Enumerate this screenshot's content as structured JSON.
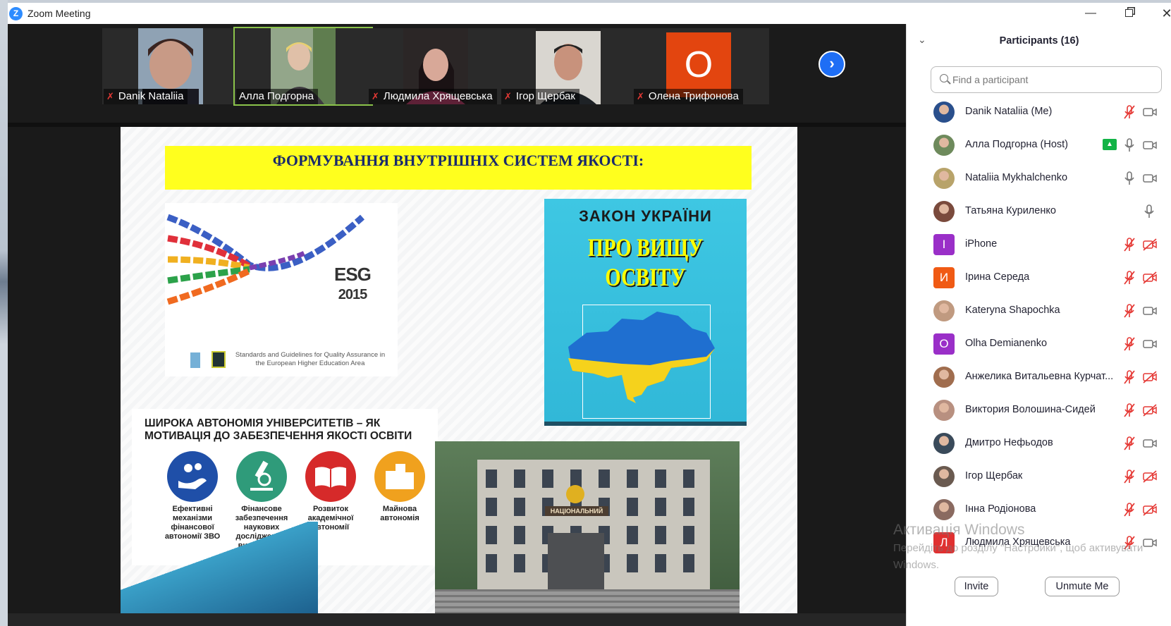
{
  "window": {
    "title": "Zoom Meeting",
    "minimize": "—",
    "close": "✕"
  },
  "video_strip": {
    "tiles": [
      {
        "name": "Danik Nataliia",
        "muted": true
      },
      {
        "name": "Алла Подгорна",
        "muted": false,
        "active_speaker": true
      },
      {
        "name": "Людмила Хрящевська",
        "muted": true
      },
      {
        "name": "Ігор Щербак",
        "muted": true
      },
      {
        "name": "Олена Трифонова",
        "muted": true,
        "initial": "О"
      }
    ],
    "next_arrow": "›"
  },
  "slide": {
    "title": "ФОРМУВАННЯ ВНУТРІШНІХ СИСТЕМ ЯКОСТІ:",
    "esg": {
      "title_line1": "ESG",
      "title_line2": "2015",
      "caption": "Standards and Guidelines for Quality Assurance in the European Higher Education Area"
    },
    "law": {
      "line1": "ЗАКОН УКРАЇНИ",
      "line2": "ПРО ВИЩУ ОСВІТУ"
    },
    "autonomy": {
      "title": "ШИРОКА АВТОНОМІЯ УНІВЕРСИТЕТІВ – ЯК МОТИВАЦІЯ ДО ЗАБЕЗПЕЧЕННЯ ЯКОСТІ ОСВІТИ",
      "items": [
        {
          "label": "Ефективні механізми фінансової автономії ЗВО",
          "color": "#1f4fa8"
        },
        {
          "label": "Фінансове забезпечення наукових досліджень у вищій освіті",
          "color": "#2f9b7a"
        },
        {
          "label": "Розвиток академічної автономії",
          "color": "#d62a2a"
        },
        {
          "label": "Майнова автономія",
          "color": "#f0a11e"
        }
      ]
    },
    "building": {
      "sign": "НАЦІОНАЛЬНИЙ"
    }
  },
  "participants_panel": {
    "title": "Participants (16)",
    "search_placeholder": "Find a participant",
    "participants": [
      {
        "name": "Danik Nataliia (Me)",
        "avatar": "photo",
        "avatar_color": "#2a4f8c",
        "mic": "muted",
        "cam": "off"
      },
      {
        "name": "Алла Подгорна (Host)",
        "avatar": "photo",
        "avatar_color": "#6e8a5c",
        "mic": "on",
        "cam": "off",
        "sharing": true
      },
      {
        "name": "Nataliia Mykhalchenko",
        "avatar": "photo",
        "avatar_color": "#b8a36a",
        "mic": "on",
        "cam": "off"
      },
      {
        "name": "Татьяна Куриленко",
        "avatar": "photo",
        "avatar_color": "#7a4a3c",
        "mic": "on",
        "cam": "none"
      },
      {
        "name": "iPhone",
        "avatar": "I",
        "avatar_color": "#9a2fc8",
        "mic": "muted",
        "cam": "muted"
      },
      {
        "name": "Ірина Середа",
        "avatar": "И",
        "avatar_color": "#f05a14",
        "mic": "muted",
        "cam": "muted"
      },
      {
        "name": "Kateryna Shapochka",
        "avatar": "photo",
        "avatar_color": "#c09a80",
        "mic": "muted",
        "cam": "off"
      },
      {
        "name": "Olha Demianenko",
        "avatar": "O",
        "avatar_color": "#9a2fc8",
        "mic": "muted",
        "cam": "off"
      },
      {
        "name": "Анжелика Витальевна Курчат...",
        "avatar": "photo",
        "avatar_color": "#a06d4e",
        "mic": "muted",
        "cam": "muted"
      },
      {
        "name": "Виктория Волошина-Сидей",
        "avatar": "photo",
        "avatar_color": "#b89080",
        "mic": "muted",
        "cam": "muted"
      },
      {
        "name": "Дмитро Нефьодов",
        "avatar": "photo",
        "avatar_color": "#3a4a5a",
        "mic": "muted",
        "cam": "off"
      },
      {
        "name": "Ігор Щербак",
        "avatar": "photo",
        "avatar_color": "#6a5a50",
        "mic": "muted",
        "cam": "muted"
      },
      {
        "name": "Інна Родіонова",
        "avatar": "photo",
        "avatar_color": "#8a6a60",
        "mic": "muted",
        "cam": "muted"
      },
      {
        "name": "Людмила Хрящевська",
        "avatar": "Л",
        "avatar_color": "#e03030",
        "mic": "muted",
        "cam": "off"
      }
    ],
    "invite_label": "Invite",
    "unmute_label": "Unmute Me"
  },
  "watermark": {
    "line1": "Активація Windows",
    "line2": "Перейдіть до розділу \"Настройки\", щоб активувати Windows."
  },
  "colors": {
    "zoom_blue": "#2d8cff",
    "muted_red": "#e53935",
    "share_green": "#12b346",
    "slide_title_bg": "#ffff1e"
  }
}
